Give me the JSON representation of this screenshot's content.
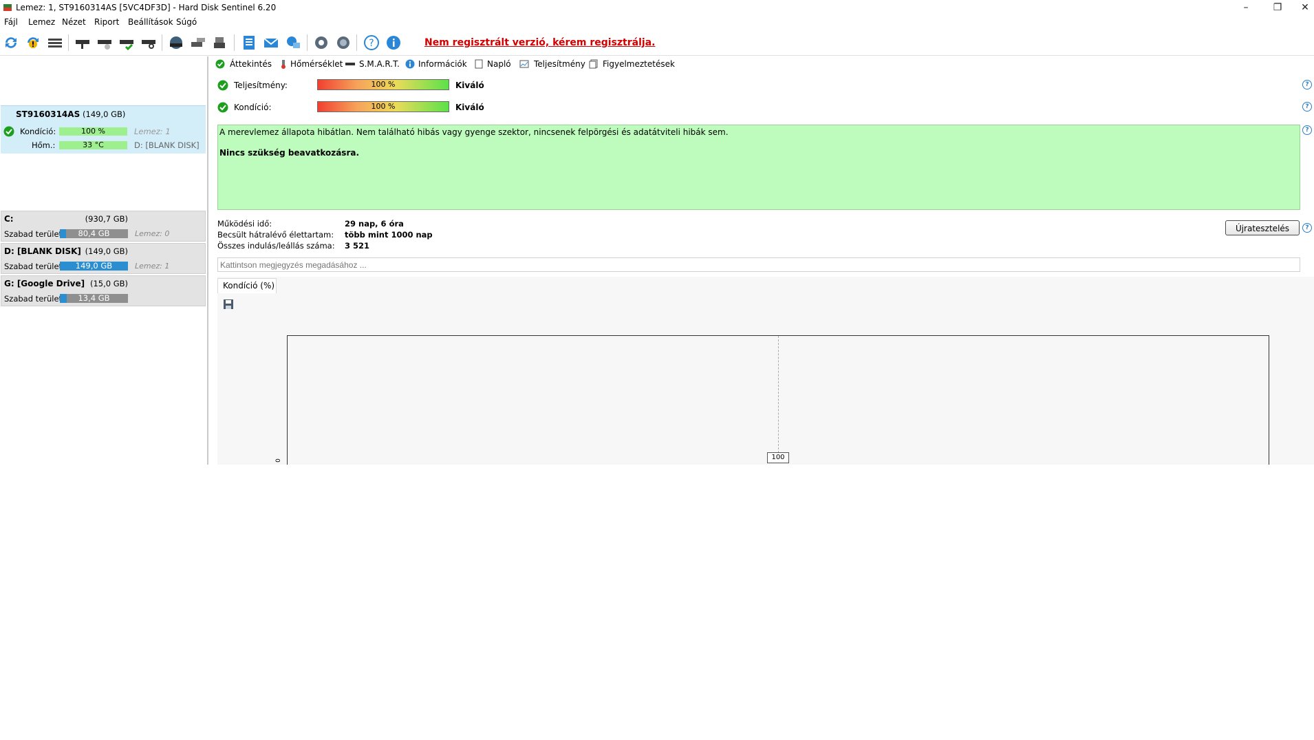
{
  "window": {
    "title": "Lemez: 1, ST9160314AS [5VC4DF3D]  -  Hard Disk Sentinel 6.20",
    "controls": [
      "–",
      "❐",
      "✕"
    ]
  },
  "menu": [
    "Fájl",
    "Lemez",
    "Nézet",
    "Riport",
    "Beállítások",
    "Súgó"
  ],
  "toolbar": {
    "registration_link": "Nem regisztrált verzió, kérem regisztrálja."
  },
  "disk": {
    "name": "ST9160314AS",
    "size": "(149,0 GB)",
    "condition_label": "Kondíció:",
    "condition_value": "100 %",
    "condition_fraction": 1.0,
    "disk_ref": "Lemez: 1",
    "temp_label": "Hőm.:",
    "temp_value": "33 °C",
    "drive_ref": "D: [BLANK DISK]"
  },
  "volumes": [
    {
      "name": "C:",
      "size": "(930,7 GB)",
      "free_label": "Szabad terület",
      "free_value": "80,4 GB",
      "free_fraction": 0.086,
      "disk": "Lemez: 0"
    },
    {
      "name": "D: [BLANK DISK]",
      "size": "(149,0 GB)",
      "free_label": "Szabad terület",
      "free_value": "149,0 GB",
      "free_fraction": 1.0,
      "disk": "Lemez: 1"
    },
    {
      "name": "G: [Google Drive]",
      "size": "(15,0 GB)",
      "free_label": "Szabad terület",
      "free_value": "13,4 GB",
      "free_fraction": 0.1,
      "disk": ""
    }
  ],
  "tabs": [
    "Áttekintés",
    "Hőmérséklet",
    "S.M.A.R.T.",
    "Információk",
    "Napló",
    "Teljesítmény",
    "Figyelmeztetések"
  ],
  "overview": {
    "performance_label": "Teljesítmény:",
    "performance_value": "100 %",
    "performance_rating": "Kiváló",
    "condition_label": "Kondíció:",
    "condition_value": "100 %",
    "condition_rating": "Kiváló",
    "status_line1": "A merevlemez állapota hibátlan. Nem található hibás vagy gyenge szektor, nincsenek felpörgési és adatátviteli hibák sem.",
    "status_line2": "Nincs szükség beavatkozásra.",
    "uptime_label": "Működési idő:",
    "uptime_value": "29 nap, 6 óra",
    "lifetime_label": "Becsült hátralévő élettartam:",
    "lifetime_value": "több mint 1000 nap",
    "startstop_label": "Összes indulás/leállás száma:",
    "startstop_value": "3 521",
    "retest_button": "Újratesztelés",
    "note_placeholder": "Kattintson megjegyzés megadásához ...",
    "help_symbol": "?"
  },
  "graph": {
    "tab_label": "Kondíció  (%)",
    "point_label": "100",
    "y_tick": "0"
  },
  "colors": {
    "selected_disk_bg": "#d3eef9",
    "status_ok_bg": "#bdfcbd",
    "registration_red": "#d40000",
    "volume_bar_blue": "#2a8ed0"
  }
}
